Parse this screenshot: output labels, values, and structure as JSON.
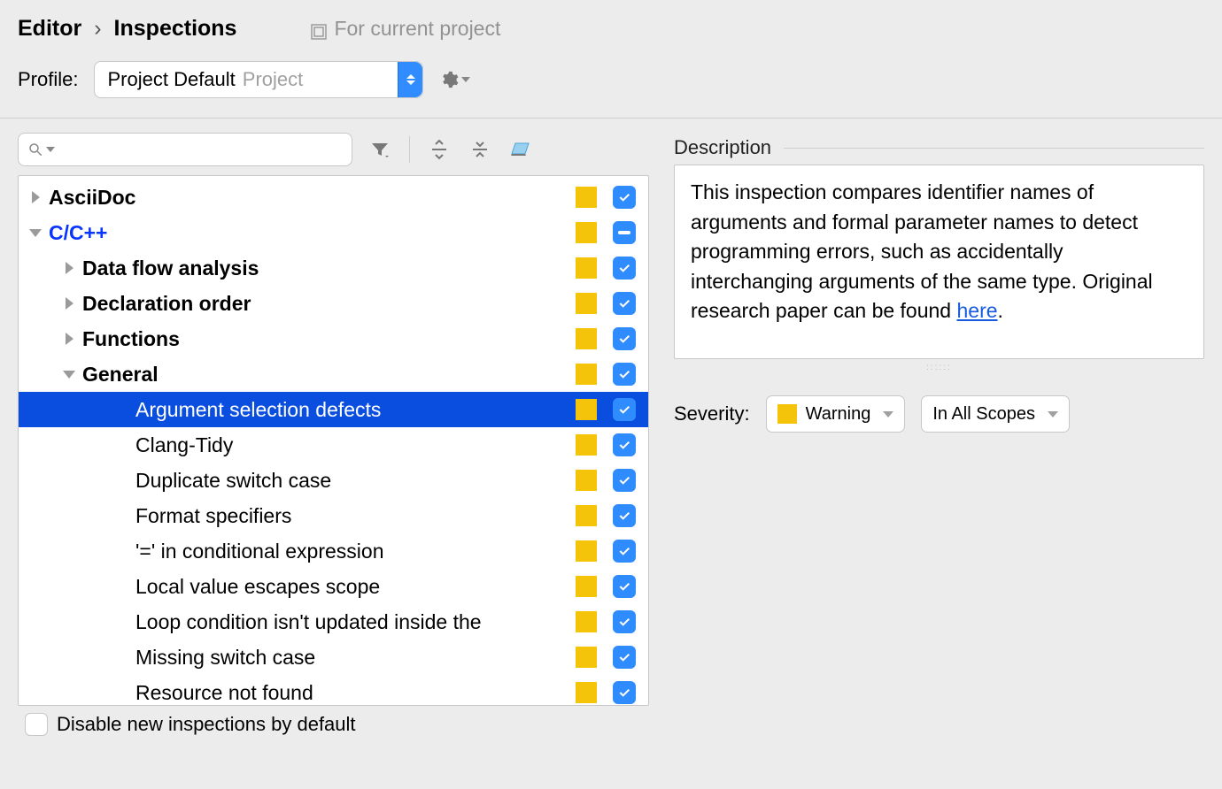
{
  "breadcrumb": {
    "editor": "Editor",
    "inspections": "Inspections"
  },
  "current_project_label": "For current project",
  "profile": {
    "label": "Profile:",
    "selected_name": "Project Default",
    "selected_scope": "Project"
  },
  "tree": [
    {
      "label": "AsciiDoc",
      "bold": true,
      "level": 0,
      "expand": "right",
      "check": "check"
    },
    {
      "label": "C/C++",
      "bold": true,
      "blue": true,
      "level": 0,
      "expand": "down",
      "check": "indet"
    },
    {
      "label": "Data flow analysis",
      "bold": true,
      "level": 1,
      "expand": "right",
      "check": "check"
    },
    {
      "label": "Declaration order",
      "bold": true,
      "level": 1,
      "expand": "right",
      "check": "check"
    },
    {
      "label": "Functions",
      "bold": true,
      "level": 1,
      "expand": "right",
      "check": "check"
    },
    {
      "label": "General",
      "bold": true,
      "level": 1,
      "expand": "down",
      "check": "check"
    },
    {
      "label": "Argument selection defects",
      "level": 2,
      "check": "check",
      "selected": true
    },
    {
      "label": "Clang-Tidy",
      "level": 2,
      "check": "check"
    },
    {
      "label": "Duplicate switch case",
      "level": 2,
      "check": "check"
    },
    {
      "label": "Format specifiers",
      "level": 2,
      "check": "check"
    },
    {
      "label": "'=' in conditional expression",
      "level": 2,
      "check": "check"
    },
    {
      "label": "Local value escapes scope",
      "level": 2,
      "check": "check"
    },
    {
      "label": "Loop condition isn't updated inside the",
      "level": 2,
      "check": "check"
    },
    {
      "label": "Missing switch case",
      "level": 2,
      "check": "check"
    },
    {
      "label": "Resource not found",
      "level": 2,
      "check": "check"
    }
  ],
  "disable_new_label": "Disable new inspections by default",
  "description": {
    "title": "Description",
    "body_before_link": "This inspection compares identifier names of arguments and formal parameter names to detect programming errors, such as accidentally interchanging arguments of the same type. Original research paper can be found ",
    "link_text": "here",
    "body_after_link": "."
  },
  "severity": {
    "label": "Severity:",
    "level": "Warning",
    "scope": "In All Scopes"
  }
}
